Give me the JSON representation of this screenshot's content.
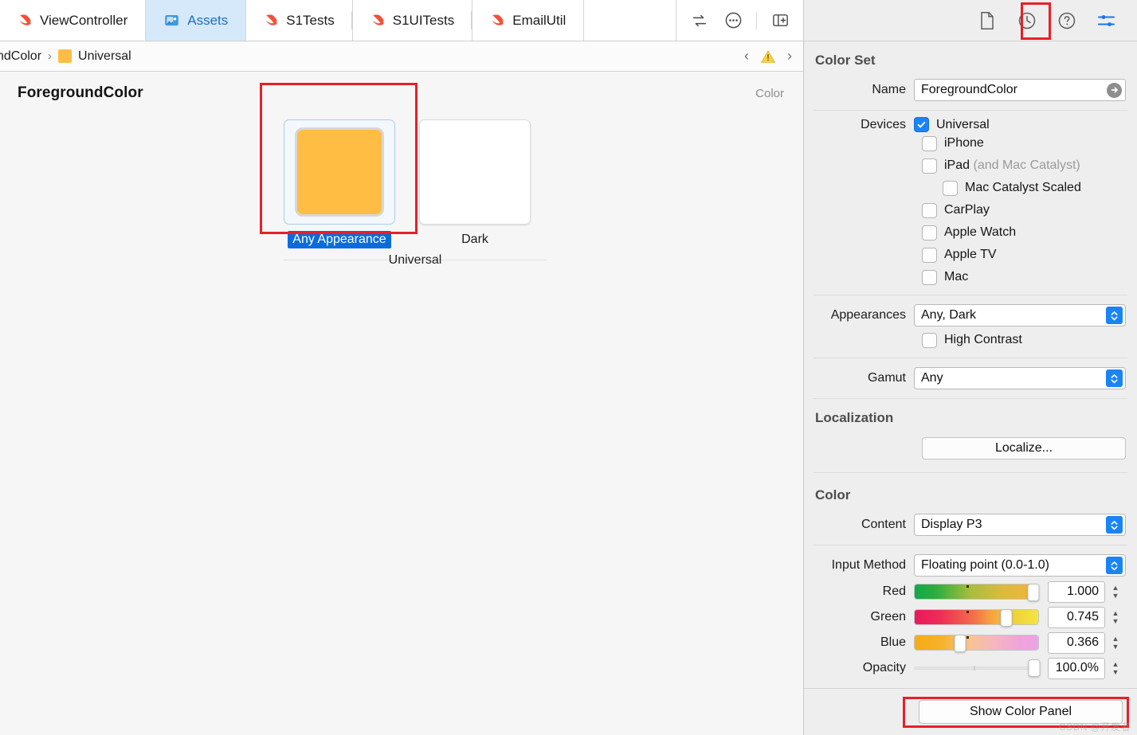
{
  "tabbar": {
    "tabs": [
      {
        "label": "ViewController",
        "icon": "swift-file-icon",
        "active": false
      },
      {
        "label": "Assets",
        "icon": "assets-catalog-icon",
        "active": true
      },
      {
        "label": "S1Tests",
        "icon": "swift-file-icon",
        "active": false
      },
      {
        "label": "S1UITests",
        "icon": "swift-file-icon",
        "active": false
      },
      {
        "label": "EmailUtil",
        "icon": "swift-file-icon",
        "active": false
      }
    ],
    "actions": [
      {
        "name": "related-items-icon"
      },
      {
        "name": "more-options-icon"
      },
      {
        "name": "add-editor-icon"
      }
    ]
  },
  "jumpbar": {
    "crumb_truncated": "ndColor",
    "crumb_chevron": "›",
    "crumb_current": "Universal",
    "crumb_swatch_color": "#ffbe43",
    "nav_back": "‹",
    "nav_forward": "›",
    "warning_icon": "warning-triangle-icon"
  },
  "canvas": {
    "asset_name": "ForegroundColor",
    "kind_label": "Color",
    "group_label": "Universal",
    "swatches": [
      {
        "label": "Any Appearance",
        "color": "#ffbe43",
        "selected": true
      },
      {
        "label": "Dark",
        "color": "#ffffff",
        "selected": false
      }
    ]
  },
  "inspector": {
    "toolbar_icons": [
      {
        "name": "file-inspector-icon",
        "active": false
      },
      {
        "name": "history-inspector-icon",
        "active": false
      },
      {
        "name": "quick-help-icon",
        "active": false
      },
      {
        "name": "attributes-inspector-icon",
        "active": true
      }
    ],
    "color_set": {
      "section_title": "Color Set",
      "name_label": "Name",
      "name_value": "ForegroundColor",
      "devices_label": "Devices",
      "devices": [
        {
          "label": "Universal",
          "checked": true,
          "sub": "",
          "indent": false
        },
        {
          "label": "iPhone",
          "checked": false,
          "sub": "",
          "indent": false
        },
        {
          "label": "iPad",
          "checked": false,
          "sub": "(and Mac Catalyst)",
          "indent": false
        },
        {
          "label": "Mac Catalyst Scaled",
          "checked": false,
          "sub": "",
          "indent": true
        },
        {
          "label": "CarPlay",
          "checked": false,
          "sub": "",
          "indent": false
        },
        {
          "label": "Apple Watch",
          "checked": false,
          "sub": "",
          "indent": false
        },
        {
          "label": "Apple TV",
          "checked": false,
          "sub": "",
          "indent": false
        },
        {
          "label": "Mac",
          "checked": false,
          "sub": "",
          "indent": false
        }
      ],
      "appearances_label": "Appearances",
      "appearances_value": "Any, Dark",
      "high_contrast_label": "High Contrast",
      "high_contrast_checked": false,
      "gamut_label": "Gamut",
      "gamut_value": "Any"
    },
    "localization": {
      "section_title": "Localization",
      "localize_button": "Localize..."
    },
    "color": {
      "section_title": "Color",
      "content_label": "Content",
      "content_value": "Display P3",
      "input_method_label": "Input Method",
      "input_method_value": "Floating point (0.0-1.0)",
      "channels": [
        {
          "label": "Red",
          "value": "1.000",
          "pct": 100.0,
          "gradient": "linear-gradient(to right,#11a849 0%,#2fae3f 18%,#a8bd3c 45%,#d9bb3c 70%,#f4b43b 100%)",
          "tick": 42
        },
        {
          "label": "Green",
          "value": "0.745",
          "pct": 74.5,
          "gradient": "linear-gradient(to right,#e9195b 0%,#ee2b56 20%,#f2704a 48%,#f6a441 62%,#f0d03c 80%,#f5e53e 100%)",
          "tick": 42
        },
        {
          "label": "Blue",
          "value": "0.366",
          "pct": 36.6,
          "gradient": "linear-gradient(to right,#f5ab16 0%,#f6b22b 22%,#f8c493 45%,#f4b6c0 65%,#efa4d9 85%,#eda2e6 100%)",
          "tick": 42
        },
        {
          "label": "Opacity",
          "value": "100.0%",
          "pct": 100.0,
          "gradient": "",
          "tick": 48,
          "plain": true
        }
      ]
    },
    "footer": {
      "show_color_panel": "Show Color Panel",
      "watermark": "CSDN @开发者"
    }
  }
}
